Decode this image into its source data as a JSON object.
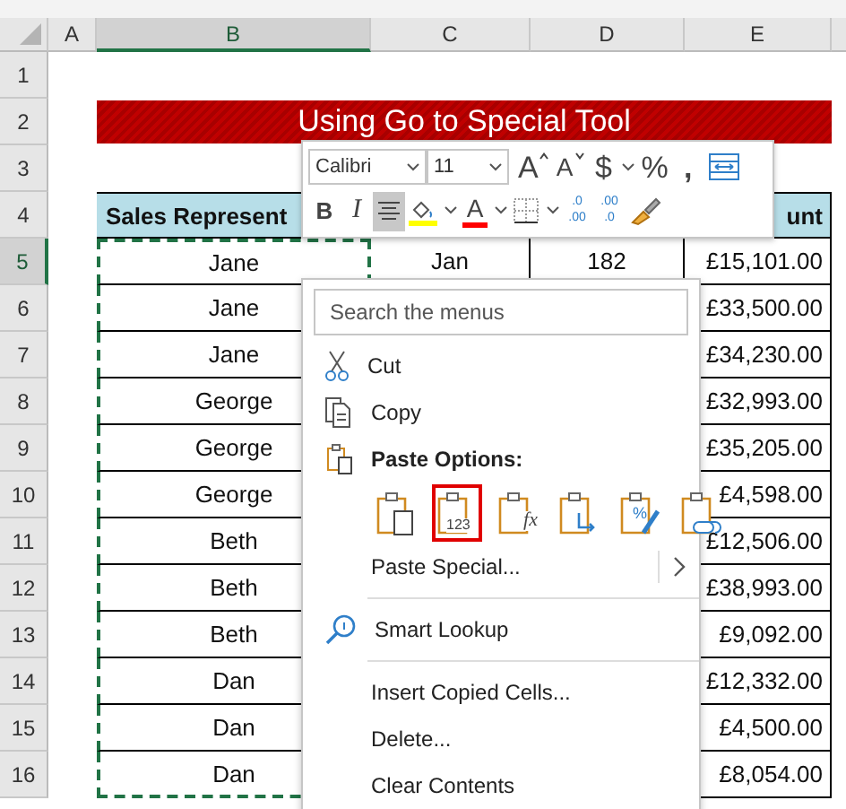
{
  "sheet": {
    "columns": [
      {
        "label": "A",
        "selected": false
      },
      {
        "label": "B",
        "selected": true
      },
      {
        "label": "C",
        "selected": false
      },
      {
        "label": "D",
        "selected": false
      },
      {
        "label": "E",
        "selected": false
      }
    ],
    "rows": [
      {
        "label": "1",
        "selected": false
      },
      {
        "label": "2",
        "selected": false
      },
      {
        "label": "3",
        "selected": false
      },
      {
        "label": "4",
        "selected": false
      },
      {
        "label": "5",
        "selected": true
      },
      {
        "label": "6",
        "selected": false
      },
      {
        "label": "7",
        "selected": false
      },
      {
        "label": "8",
        "selected": false
      },
      {
        "label": "9",
        "selected": false
      },
      {
        "label": "10",
        "selected": false
      },
      {
        "label": "11",
        "selected": false
      },
      {
        "label": "12",
        "selected": false
      },
      {
        "label": "13",
        "selected": false
      },
      {
        "label": "14",
        "selected": false
      },
      {
        "label": "15",
        "selected": false
      },
      {
        "label": "16",
        "selected": false
      }
    ]
  },
  "title": "Using Go to Special Tool",
  "table": {
    "copy_marquee": true,
    "header": {
      "column_b": "Sales Represent",
      "column_e": "unt"
    },
    "rows": [
      {
        "column_b": "Jane",
        "column_c": "Jan",
        "column_d": "182",
        "column_e": "£15,101.00"
      },
      {
        "column_b": "Jane",
        "column_e": "£33,500.00"
      },
      {
        "column_b": "Jane",
        "column_e": "£34,230.00"
      },
      {
        "column_b": "George",
        "column_e": "£32,993.00"
      },
      {
        "column_b": "George",
        "column_e": "£35,205.00"
      },
      {
        "column_b": "George",
        "column_e": "£4,598.00"
      },
      {
        "column_b": "Beth",
        "column_e": "£12,506.00"
      },
      {
        "column_b": "Beth",
        "column_e": "£38,993.00"
      },
      {
        "column_b": "Beth",
        "column_e": "£9,092.00"
      },
      {
        "column_b": "Dan",
        "column_e": "£12,332.00"
      },
      {
        "column_b": "Dan",
        "column_e": "£4,500.00"
      },
      {
        "column_b": "Dan",
        "column_e": "£8,054.00"
      }
    ]
  },
  "mini_toolbar": {
    "font": "Calibri",
    "size": "11",
    "row_1": [
      {
        "kind": "grow",
        "glyph": "A"
      },
      {
        "kind": "shrink",
        "glyph": "A"
      },
      {
        "kind": "currency",
        "glyph": "$"
      },
      {
        "kind": "dropdown"
      },
      {
        "kind": "percent",
        "glyph": "%"
      },
      {
        "kind": "comma",
        "glyph": ","
      },
      {
        "kind": "wrap"
      }
    ],
    "row_2": [
      {
        "kind": "bold",
        "glyph": "B",
        "selected": false
      },
      {
        "kind": "italic",
        "glyph": "I",
        "selected": false
      },
      {
        "kind": "center",
        "selected": true
      },
      {
        "kind": "fill",
        "color": "#ffff00",
        "selected": false
      },
      {
        "kind": "dropdown",
        "selected": false
      },
      {
        "kind": "font_color",
        "glyph": "A",
        "color": "#ff0000",
        "selected": false
      },
      {
        "kind": "dropdown",
        "selected": false
      },
      {
        "kind": "borders",
        "selected": false
      },
      {
        "kind": "dropdown",
        "selected": false
      },
      {
        "kind": "increase_decimal",
        "lines": [
          ".0",
          ".00"
        ],
        "selected": false
      },
      {
        "kind": "decrease_decimal",
        "lines": [
          ".00",
          ".0"
        ],
        "selected": false
      },
      {
        "kind": "painter",
        "selected": false
      }
    ]
  },
  "context_menu": {
    "search_placeholder": "Search the menus",
    "items": [
      {
        "kind": "cut",
        "label": "Cut"
      },
      {
        "kind": "copy",
        "label": "Copy"
      },
      {
        "kind": "paste_options",
        "label": "Paste Options:",
        "buttons": [
          {
            "kind": "paste",
            "selected": false
          },
          {
            "kind": "values",
            "glyph": "123",
            "selected": true
          },
          {
            "kind": "formulas",
            "glyph": "fx",
            "selected": false
          },
          {
            "kind": "transpose",
            "selected": false
          },
          {
            "kind": "formatting",
            "glyph": "%",
            "selected": false
          },
          {
            "kind": "link",
            "selected": false
          }
        ]
      },
      {
        "kind": "paste_special",
        "label": "Paste Special...",
        "submenu": true
      },
      {
        "kind": "separator"
      },
      {
        "kind": "lookup",
        "label": "Smart Lookup"
      },
      {
        "kind": "separator"
      },
      {
        "kind": "command",
        "label": "Insert Copied Cells..."
      },
      {
        "kind": "command",
        "label": "Delete..."
      },
      {
        "kind": "command",
        "label": "Clear Contents"
      }
    ]
  }
}
